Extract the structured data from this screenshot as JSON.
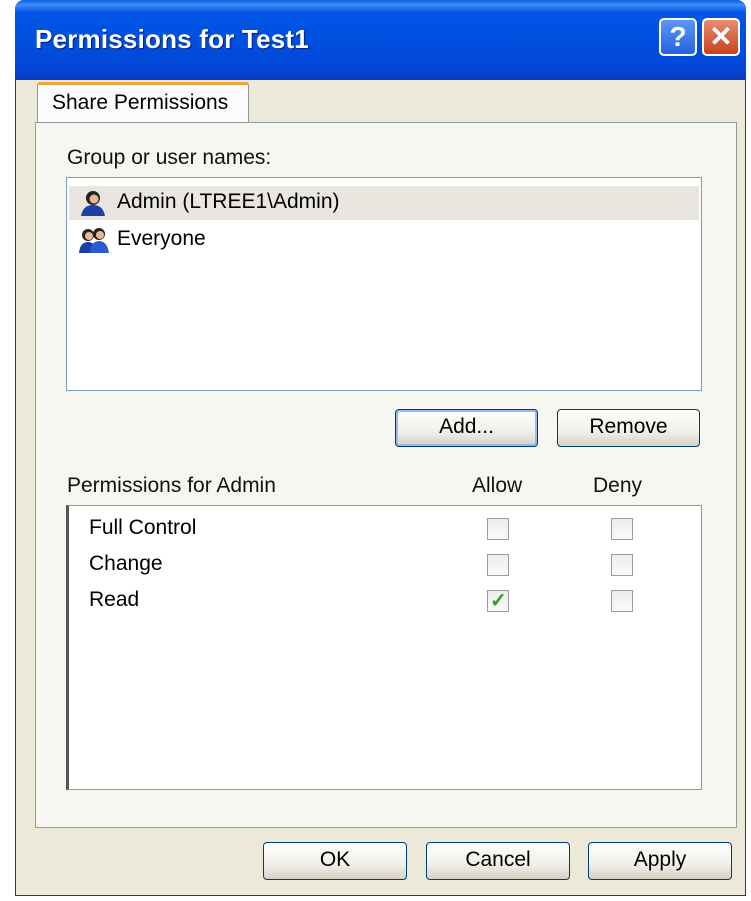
{
  "window": {
    "title": "Permissions for Test1",
    "help_glyph": "?",
    "close_glyph": "✕"
  },
  "tabs": [
    {
      "label": "Share Permissions",
      "active": true
    }
  ],
  "users": {
    "label": "Group or user names:",
    "items": [
      {
        "name": "Admin (LTREE1\\Admin)",
        "icon": "user-icon",
        "selected": true
      },
      {
        "name": "Everyone",
        "icon": "group-icon",
        "selected": false
      }
    ],
    "add_label": "Add...",
    "remove_label": "Remove"
  },
  "permissions": {
    "title": "Permissions for Admin",
    "allow_header": "Allow",
    "deny_header": "Deny",
    "rows": [
      {
        "name": "Full Control",
        "allow": false,
        "deny": false
      },
      {
        "name": "Change",
        "allow": false,
        "deny": false
      },
      {
        "name": "Read",
        "allow": true,
        "deny": false
      }
    ]
  },
  "footer": {
    "ok": "OK",
    "cancel": "Cancel",
    "apply": "Apply"
  },
  "colors": {
    "accent": "#0055E5",
    "tab_highlight": "#F2A23C",
    "check": "#2E9E2E"
  }
}
